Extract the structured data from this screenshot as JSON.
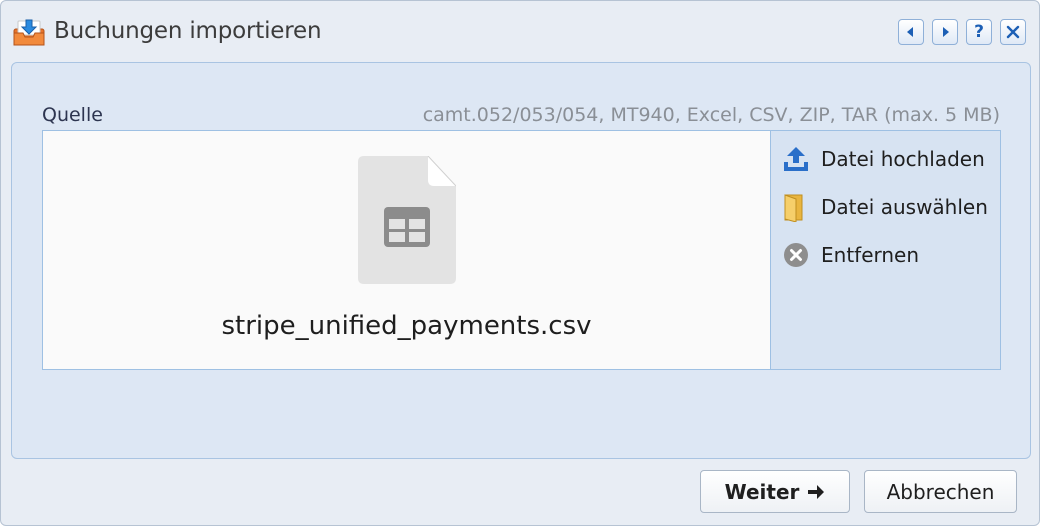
{
  "dialog": {
    "title": "Buchungen importieren",
    "title_icon": "import-tray-icon",
    "titlebar_buttons": [
      {
        "name": "prev-button",
        "icon": "triangle-left-icon"
      },
      {
        "name": "next-button",
        "icon": "triangle-right-icon"
      },
      {
        "name": "help-button",
        "icon": "question-icon",
        "glyph": "?"
      },
      {
        "name": "close-button",
        "icon": "close-icon"
      }
    ]
  },
  "source": {
    "label": "Quelle",
    "formats_hint": "camt.052/053/054, MT940, Excel, CSV, ZIP, TAR (max. 5 MB)",
    "file": {
      "name": "stripe_unified_payments.csv",
      "icon": "spreadsheet-file-icon"
    },
    "actions": [
      {
        "label": "Datei hochladen",
        "icon": "upload-icon"
      },
      {
        "label": "Datei auswählen",
        "icon": "folder-icon"
      },
      {
        "label": "Entfernen",
        "icon": "remove-circle-icon"
      }
    ]
  },
  "footer": {
    "next_label": "Weiter",
    "next_icon": "arrow-right-icon",
    "cancel_label": "Abbrechen"
  },
  "colors": {
    "dialog_bg": "#e8edf4",
    "panel_bg": "#dde7f4",
    "panel_border": "#a9c4e2",
    "accent_blue": "#2a6fc9",
    "folder_yellow": "#f0c14b",
    "remove_gray": "#8e8e8e"
  }
}
